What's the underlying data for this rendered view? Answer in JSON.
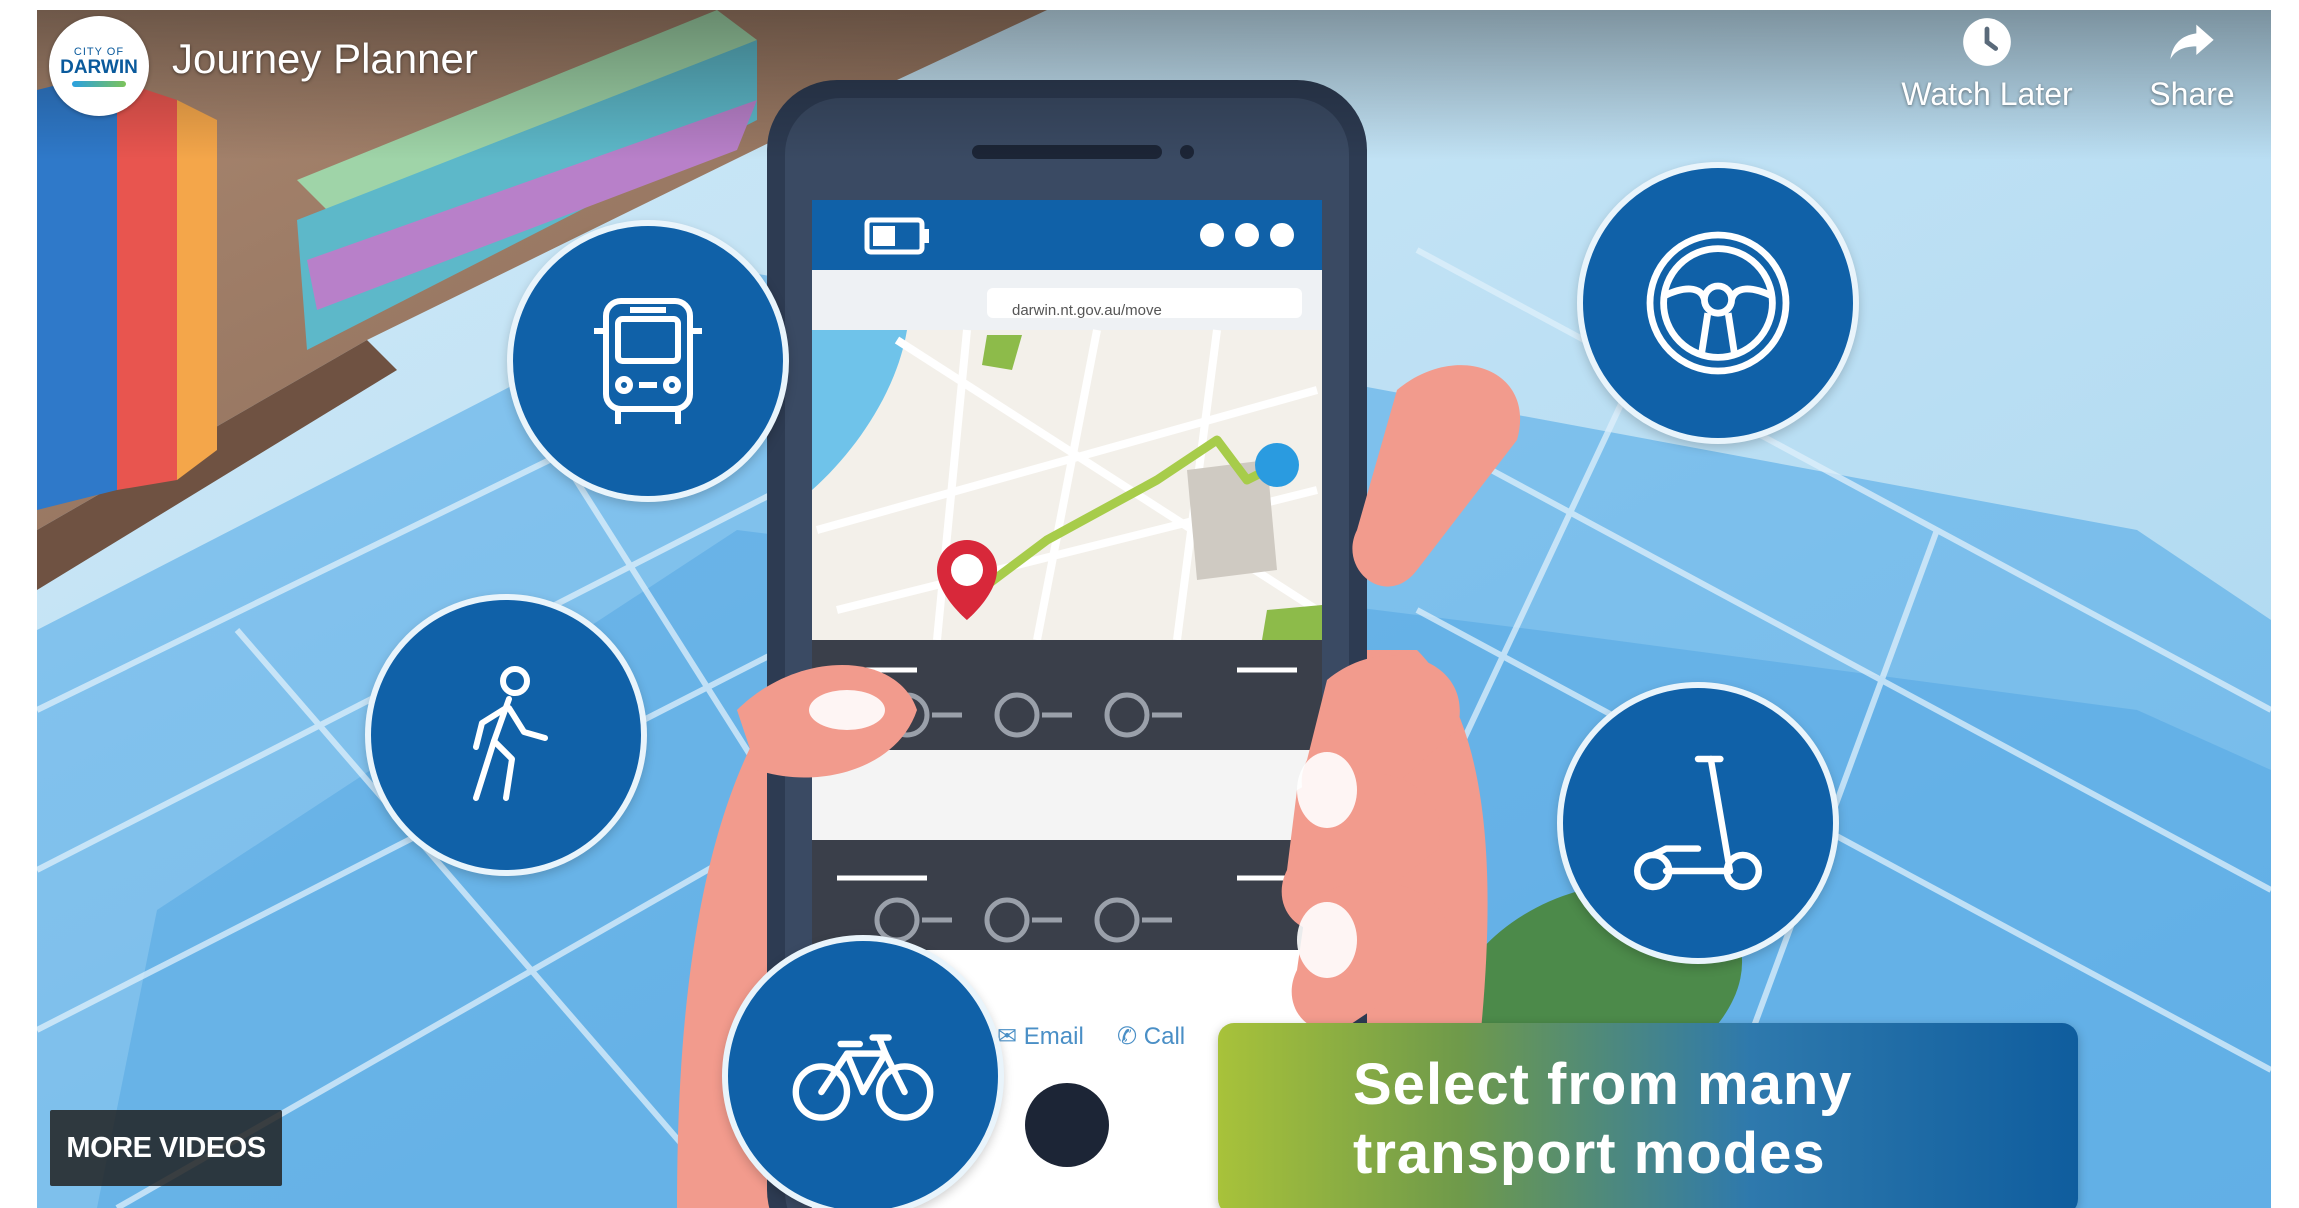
{
  "player": {
    "title": "Journey Planner",
    "channel_logo": {
      "small_text": "CITY OF",
      "main_text": "DARWIN"
    },
    "controls": {
      "watch_later": {
        "label": "Watch Later",
        "icon": "clock-icon"
      },
      "share": {
        "label": "Share",
        "icon": "share-arrow-icon"
      }
    },
    "more_videos_label": "MORE VIDEOS"
  },
  "video_frame": {
    "caption": {
      "line1": "Select from many",
      "line2": "transport modes"
    },
    "phone_screen": {
      "url": "darwin.nt.gov.au/move",
      "contact_email": "Email",
      "contact_call": "Call"
    },
    "transport_icons": [
      "bus-icon",
      "walking-person-icon",
      "bicycle-icon",
      "steering-wheel-icon",
      "scooter-icon"
    ]
  },
  "colors": {
    "brand_blue": "#1061a8",
    "caption_gradient_start": "#a8c23a",
    "caption_gradient_end": "#0f5d9e",
    "more_videos_bg": "#212121"
  }
}
